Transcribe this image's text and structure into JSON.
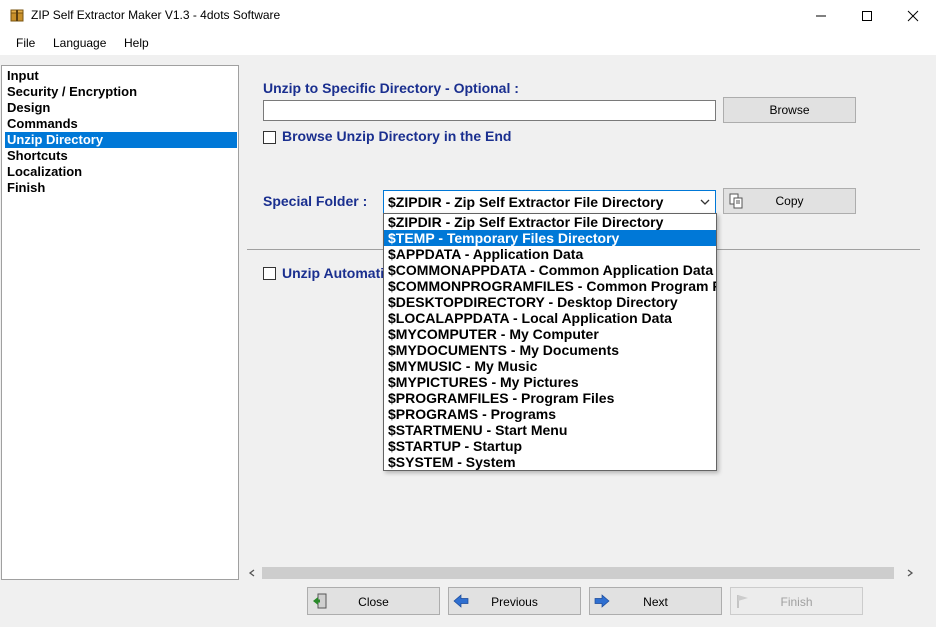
{
  "window": {
    "title": "ZIP Self Extractor Maker V1.3 - 4dots Software"
  },
  "menu": [
    "File",
    "Language",
    "Help"
  ],
  "nav": {
    "items": [
      "Input",
      "Security / Encryption",
      "Design",
      "Commands",
      "Unzip Directory",
      "Shortcuts",
      "Localization",
      "Finish"
    ],
    "selected": "Unzip Directory"
  },
  "content": {
    "unzip_label": "Unzip to Specific Directory - Optional :",
    "unzip_value": "",
    "browse_label": "Browse",
    "browse_end_label": "Browse Unzip Directory in the End",
    "special_folder_label": "Special Folder :",
    "special_folder_value": "$ZIPDIR - Zip Self Extractor File Directory",
    "copy_label": "Copy",
    "unzip_auto_label": "Unzip Automatically"
  },
  "dropdown": {
    "options": [
      "$ZIPDIR - Zip Self Extractor File Directory",
      "$TEMP - Temporary Files Directory",
      "$APPDATA - Application Data",
      "$COMMONAPPDATA - Common Application Data",
      "$COMMONPROGRAMFILES - Common Program Files",
      "$DESKTOPDIRECTORY - Desktop Directory",
      "$LOCALAPPDATA - Local Application Data",
      "$MYCOMPUTER - My Computer",
      "$MYDOCUMENTS - My Documents",
      "$MYMUSIC - My Music",
      "$MYPICTURES - My Pictures",
      "$PROGRAMFILES - Program Files",
      "$PROGRAMS - Programs",
      "$STARTMENU - Start Menu",
      "$STARTUP - Startup",
      "$SYSTEM - System"
    ],
    "highlighted": "$TEMP - Temporary Files Directory"
  },
  "bottom": {
    "close_label": "Close",
    "previous_label": "Previous",
    "next_label": "Next",
    "finish_label": "Finish"
  },
  "colors": {
    "accent": "#0078d7",
    "label_blue": "#1a2f8f"
  }
}
